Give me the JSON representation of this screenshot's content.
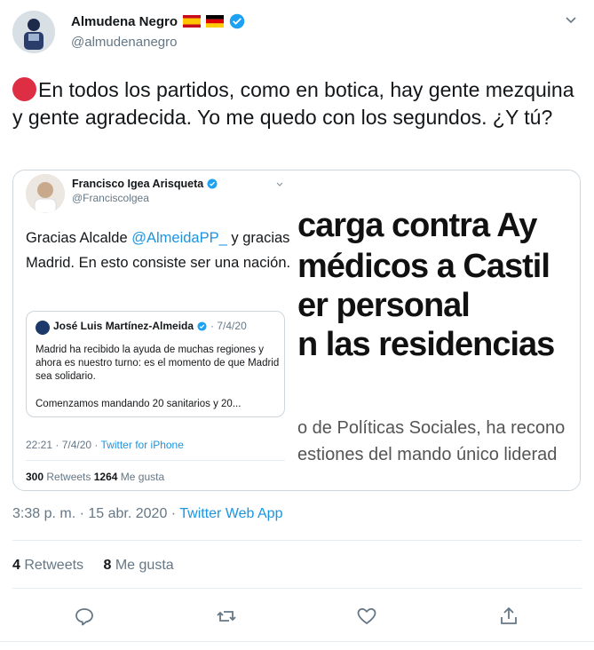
{
  "author": {
    "name": "Almudena Negro",
    "handle": "@almudenanegro",
    "flags": [
      "spain-flag-icon",
      "germany-flag-icon"
    ],
    "verified": true
  },
  "tweet": {
    "marker_icon": "red-circle-icon",
    "text": "En todos los partidos, como en botica, hay gente mezquina y gente agradecida. Yo me quedo con los segundos.  ¿Y tú?"
  },
  "quoted": {
    "name": "Francisco Igea Arisqueta",
    "handle": "@Franciscolgea",
    "text_before": "Gracias Alcalde ",
    "mention": "@AlmeidaPP_",
    "text_after": " y gracias Madrid.  En esto consiste ser una nación.",
    "nested": {
      "name": "José Luis Martínez-Almeida",
      "date": "· 7/4/20",
      "text": "Madrid ha recibido la ayuda de muchas regiones y ahora es nuestro turno: es el momento de que Madrid sea solidario.",
      "text2": "Comenzamos mandando 20 sanitarios y 20..."
    },
    "meta_time": "22:21 · 7/4/20 · ",
    "meta_app": "Twitter for iPhone",
    "retweets_count": "300",
    "retweets_label": " Retweets ",
    "likes_count": "1264",
    "likes_label": " Me gusta"
  },
  "image_text": {
    "headlines": [
      "carga contra Ay",
      "médicos a Castil",
      "er personal",
      "n las residencias"
    ],
    "sublines": [
      "o de Políticas Sociales, ha recono",
      "estiones del mando único liderad"
    ]
  },
  "timestamp": {
    "time": "3:38 p. m. · 15 abr. 2020 · ",
    "app": "Twitter Web App"
  },
  "stats": {
    "retweets_count": "4",
    "retweets_label": " Retweets",
    "likes_count": "8",
    "likes_label": " Me gusta"
  },
  "colors": {
    "link": "#1b95e0",
    "secondary_text": "#657786",
    "red_marker": "#dd2e44"
  }
}
